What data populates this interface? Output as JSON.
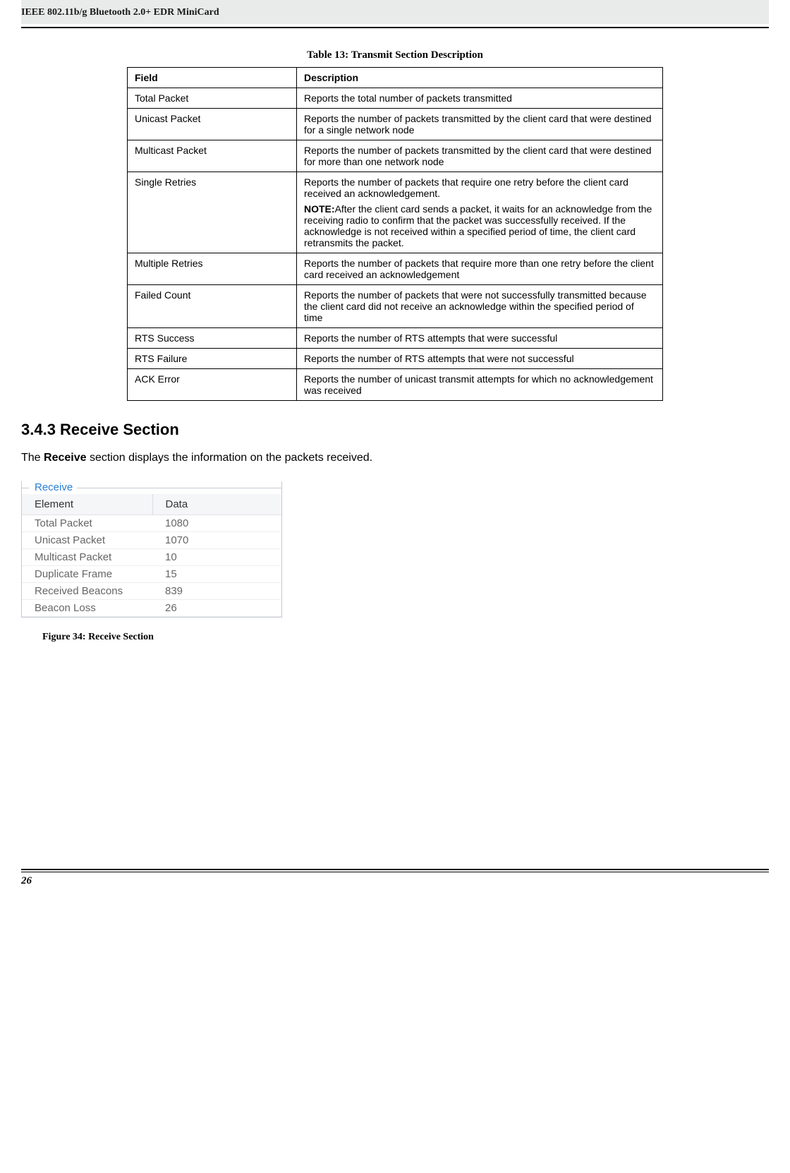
{
  "header": {
    "title": "IEEE 802.11b/g Bluetooth 2.0+ EDR MiniCard"
  },
  "table13": {
    "caption": "Table 13: Transmit Section Description",
    "headers": {
      "field": "Field",
      "description": "Description"
    },
    "rows": [
      {
        "field": "Total Packet",
        "desc": "Reports the total number of packets transmitted"
      },
      {
        "field": "Unicast Packet",
        "desc": "Reports the number of packets transmitted by the client card that were destined\nfor a single network node"
      },
      {
        "field": "Multicast Packet",
        "desc": "Reports the number of packets transmitted by the client card that were destined\nfor more than one network node"
      },
      {
        "field": "Single Retries",
        "desc_line1": "Reports the number of packets that require one retry before the client card received an acknowledgement.",
        "note_label": "NOTE:",
        "note_text": "After the client card sends a packet, it waits for an acknowledge from the receiving radio to confirm that the packet was successfully received. If the acknowledge is not received within a specified period of time, the client card retransmits the packet."
      },
      {
        "field": "Multiple Retries",
        "desc": "Reports the number of packets that require more than one retry before the client\ncard received an acknowledgement"
      },
      {
        "field": "Failed Count",
        "desc": "Reports the number of packets that were not successfully transmitted because\nthe client card did not receive an acknowledge within the specified period of time"
      },
      {
        "field": "RTS Success",
        "desc": "Reports the number of RTS attempts that were successful"
      },
      {
        "field": "RTS Failure",
        "desc": "Reports the number of RTS attempts that were not successful"
      },
      {
        "field": "ACK Error",
        "desc": "Reports the number of unicast transmit attempts for which no acknowledgement\nwas received"
      }
    ]
  },
  "section": {
    "heading": "3.4.3 Receive Section",
    "text_prefix": "The ",
    "text_bold": "Receive",
    "text_suffix": " section displays the information on the packets received."
  },
  "receive_panel": {
    "legend": "Receive",
    "headers": {
      "element": "Element",
      "data": "Data"
    },
    "rows": [
      {
        "element": "Total Packet",
        "data": "1080"
      },
      {
        "element": "Unicast Packet",
        "data": "1070"
      },
      {
        "element": "Multicast Packet",
        "data": "10"
      },
      {
        "element": "Duplicate Frame",
        "data": "15"
      },
      {
        "element": "Received Beacons",
        "data": "839"
      },
      {
        "element": "Beacon Loss",
        "data": "26"
      }
    ]
  },
  "figure_caption": "Figure 34: Receive Section",
  "page_number": "26"
}
